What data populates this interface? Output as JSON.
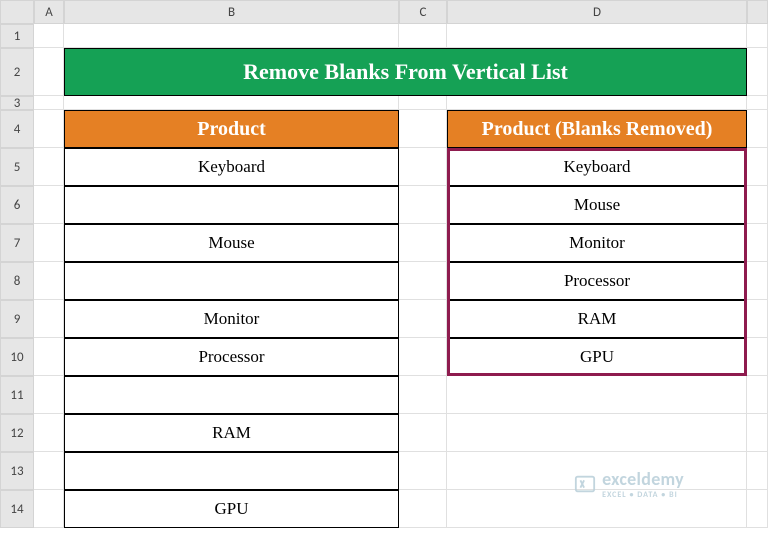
{
  "columns": [
    "A",
    "B",
    "C",
    "D"
  ],
  "row_numbers": [
    "1",
    "2",
    "3",
    "4",
    "5",
    "6",
    "7",
    "8",
    "9",
    "10",
    "11",
    "12",
    "13",
    "14"
  ],
  "title": "Remove Blanks From Vertical List",
  "table_b": {
    "header": "Product",
    "rows": [
      "Keyboard",
      "",
      "Mouse",
      "",
      "Monitor",
      "Processor",
      "",
      "RAM",
      "",
      "GPU"
    ]
  },
  "table_d": {
    "header": "Product (Blanks Removed)",
    "rows": [
      "Keyboard",
      "Mouse",
      "Monitor",
      "Processor",
      "RAM",
      "GPU"
    ]
  },
  "watermark": {
    "brand": "exceldemy",
    "tagline": "EXCEL • DATA • BI"
  },
  "chart_data": {
    "type": "table",
    "title": "Remove Blanks From Vertical List",
    "series": [
      {
        "name": "Product",
        "values": [
          "Keyboard",
          "",
          "Mouse",
          "",
          "Monitor",
          "Processor",
          "",
          "RAM",
          "",
          "GPU"
        ]
      },
      {
        "name": "Product (Blanks Removed)",
        "values": [
          "Keyboard",
          "Mouse",
          "Monitor",
          "Processor",
          "RAM",
          "GPU"
        ]
      }
    ]
  }
}
